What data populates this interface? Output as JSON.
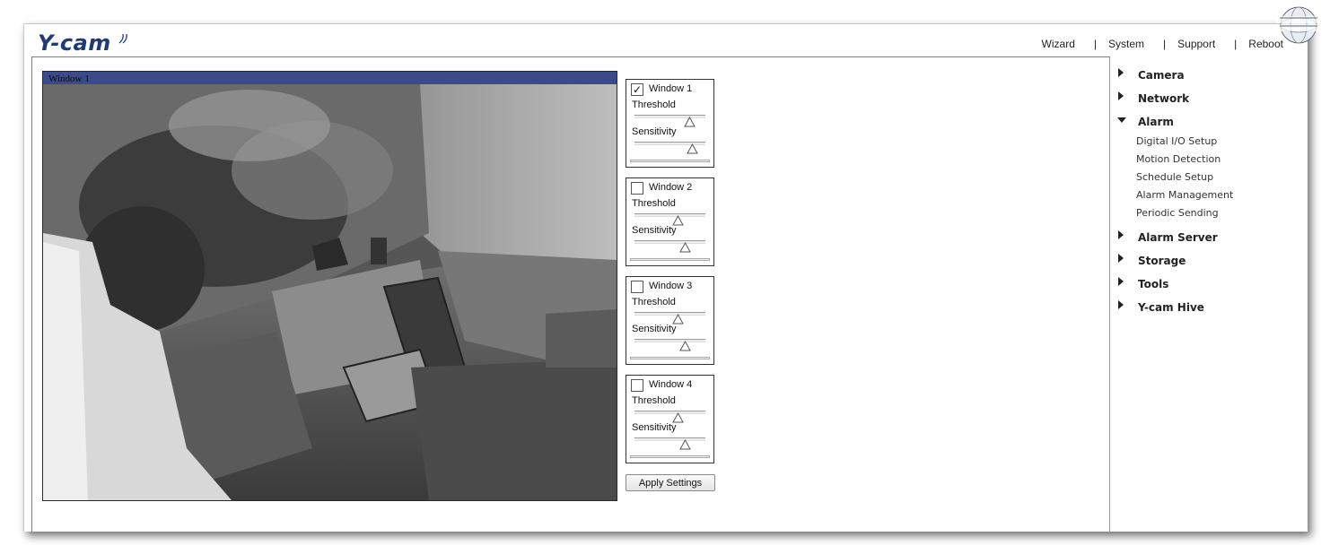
{
  "brand": {
    "logo": "Y-cam",
    "logo_color": "#1e3a7a"
  },
  "topnav": [
    {
      "label": "Wizard"
    },
    {
      "label": "System"
    },
    {
      "label": "Support"
    },
    {
      "label": "Reboot"
    }
  ],
  "video": {
    "title": "Window 1"
  },
  "windows": [
    {
      "label": "Window 1",
      "checked": true,
      "threshold_label": "Threshold",
      "sensitivity_label": "Sensitivity",
      "threshold": 0.76,
      "sensitivity": 0.79
    },
    {
      "label": "Window 2",
      "checked": false,
      "threshold_label": "Threshold",
      "sensitivity_label": "Sensitivity",
      "threshold": 0.59,
      "sensitivity": 0.72
    },
    {
      "label": "Window 3",
      "checked": false,
      "threshold_label": "Threshold",
      "sensitivity_label": "Sensitivity",
      "threshold": 0.59,
      "sensitivity": 0.72
    },
    {
      "label": "Window 4",
      "checked": false,
      "threshold_label": "Threshold",
      "sensitivity_label": "Sensitivity",
      "threshold": 0.59,
      "sensitivity": 0.72
    }
  ],
  "apply_label": "Apply Settings",
  "menu": [
    {
      "label": "Camera",
      "expanded": false
    },
    {
      "label": "Network",
      "expanded": false
    },
    {
      "label": "Alarm",
      "expanded": true,
      "children": [
        "Digital I/O Setup",
        "Motion Detection",
        "Schedule Setup",
        "Alarm Management",
        "Periodic Sending"
      ]
    },
    {
      "label": "Alarm Server",
      "expanded": false
    },
    {
      "label": "Storage",
      "expanded": false
    },
    {
      "label": "Tools",
      "expanded": false
    },
    {
      "label": "Y-cam Hive",
      "expanded": false
    }
  ],
  "icons": {
    "watermark": "planet-sanseil-globe-icon",
    "menu_arrow": "triangle-right-icon",
    "menu_arrow_open": "triangle-down-icon"
  }
}
